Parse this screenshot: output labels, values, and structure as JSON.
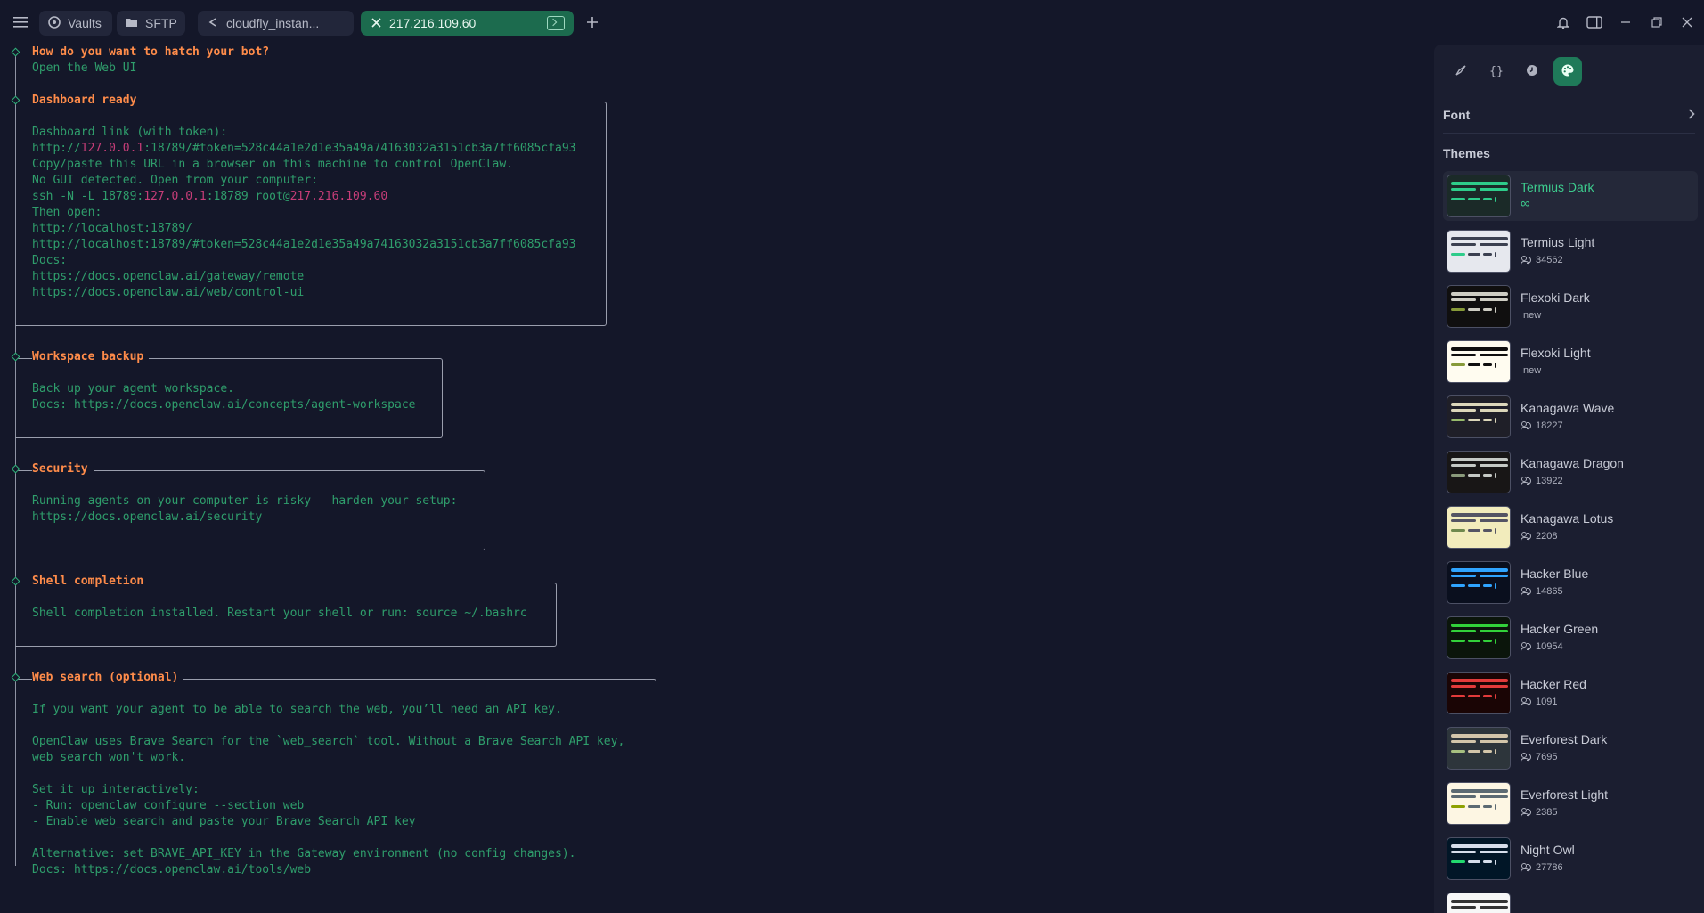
{
  "topbar": {
    "tabs": [
      {
        "label": "Vaults",
        "icon": "vault-icon"
      },
      {
        "label": "SFTP",
        "icon": "folder-icon"
      },
      {
        "label": "cloudfly_instan...",
        "icon": "terminal-prompt-icon"
      },
      {
        "label": "217.216.109.60",
        "icon": "close-icon",
        "active": true
      }
    ]
  },
  "terminal": {
    "q_title": "How do you want to hatch your bot?",
    "q_answer": "Open the Web UI",
    "dashboard": {
      "title": "Dashboard ready",
      "l1": "Dashboard link (with token):",
      "l2a": "http://",
      "l2b": "127.0.0.1",
      "l2c": ":18789/#token=528c44a1e2d1e35a49a74163032a3151cb3a7ff6085cfa93",
      "l3": "Copy/paste this URL in a browser on this machine to control OpenClaw.",
      "l4": "No GUI detected. Open from your computer:",
      "l5a": "ssh -N -L 18789:",
      "l5b": "127.0.0.1",
      "l5c": ":18789 root@",
      "l5d": "217.216.109.60",
      "l6": "Then open:",
      "l7": "http://localhost:18789/",
      "l8": "http://localhost:18789/#token=528c44a1e2d1e35a49a74163032a3151cb3a7ff6085cfa93",
      "l9": "Docs:",
      "l10": "https://docs.openclaw.ai/gateway/remote",
      "l11": "https://docs.openclaw.ai/web/control-ui"
    },
    "workspace": {
      "title": "Workspace backup",
      "l1": "Back up your agent workspace.",
      "l2": "Docs: https://docs.openclaw.ai/concepts/agent-workspace"
    },
    "security": {
      "title": "Security",
      "l1": "Running agents on your computer is risky — harden your setup:",
      "l2": "https://docs.openclaw.ai/security"
    },
    "shell": {
      "title": "Shell completion",
      "l1": "Shell completion installed. Restart your shell or run: source ~/.bashrc"
    },
    "websearch": {
      "title": "Web search (optional)",
      "l1": "If you want your agent to be able to search the web, you’ll need an API key.",
      "l2": "OpenClaw uses Brave Search for the `web_search` tool. Without a Brave Search API key,",
      "l3": "web search won't work.",
      "l4": "Set it up interactively:",
      "l5": "- Run: openclaw configure --section web",
      "l6": "- Enable web_search and paste your Brave Search API key",
      "l7": "Alternative: set BRAVE_API_KEY in the Gateway environment (no config changes).",
      "l8": "Docs: https://docs.openclaw.ai/tools/web"
    }
  },
  "panel": {
    "font_label": "Font",
    "themes_label": "Themes",
    "themes": [
      {
        "name": "Termius Dark",
        "meta": "∞",
        "bg": "#1b2a28",
        "bars": [
          "#2ecc8a",
          "#2ecc8a",
          "#2ecc8a"
        ],
        "selected": true
      },
      {
        "name": "Termius Light",
        "meta": "34562",
        "bg": "#e6e8ee",
        "bars": [
          "#3b4050",
          "#3b4050",
          "#2ecc8a"
        ]
      },
      {
        "name": "Flexoki Dark",
        "meta": "new",
        "bg": "#100f0f",
        "bars": [
          "#cecdc3",
          "#cecdc3",
          "#879a39"
        ]
      },
      {
        "name": "Flexoki Light",
        "meta": "new",
        "bg": "#fffcf0",
        "bars": [
          "#100f0f",
          "#100f0f",
          "#879a39"
        ]
      },
      {
        "name": "Kanagawa Wave",
        "meta": "18227",
        "bg": "#1f1f28",
        "bars": [
          "#dcd7ba",
          "#dcd7ba",
          "#98bb6c"
        ]
      },
      {
        "name": "Kanagawa Dragon",
        "meta": "13922",
        "bg": "#181616",
        "bars": [
          "#c5c9c5",
          "#c5c9c5",
          "#8a9a7b"
        ]
      },
      {
        "name": "Kanagawa Lotus",
        "meta": "2208",
        "bg": "#f2ecbc",
        "bars": [
          "#545464",
          "#545464",
          "#6f894e"
        ]
      },
      {
        "name": "Hacker Blue",
        "meta": "14865",
        "bg": "#0a0f1e",
        "bars": [
          "#2fa4ff",
          "#2fa4ff",
          "#2fa4ff"
        ]
      },
      {
        "name": "Hacker Green",
        "meta": "10954",
        "bg": "#0b150b",
        "bars": [
          "#32d13a",
          "#32d13a",
          "#32d13a"
        ]
      },
      {
        "name": "Hacker Red",
        "meta": "1091",
        "bg": "#1a0505",
        "bars": [
          "#e23b3b",
          "#e23b3b",
          "#e23b3b"
        ]
      },
      {
        "name": "Everforest Dark",
        "meta": "7695",
        "bg": "#2d353b",
        "bars": [
          "#d3c6aa",
          "#d3c6aa",
          "#a7c080"
        ]
      },
      {
        "name": "Everforest Light",
        "meta": "2385",
        "bg": "#fdf6e3",
        "bars": [
          "#5c6a72",
          "#5c6a72",
          "#8da101"
        ]
      },
      {
        "name": "Night Owl",
        "meta": "27786",
        "bg": "#011627",
        "bars": [
          "#d6deeb",
          "#d6deeb",
          "#22da6e"
        ]
      },
      {
        "name": "",
        "meta": "",
        "bg": "#f7f7f7",
        "bars": [
          "#333333",
          "#333333",
          "#333333"
        ]
      }
    ]
  }
}
